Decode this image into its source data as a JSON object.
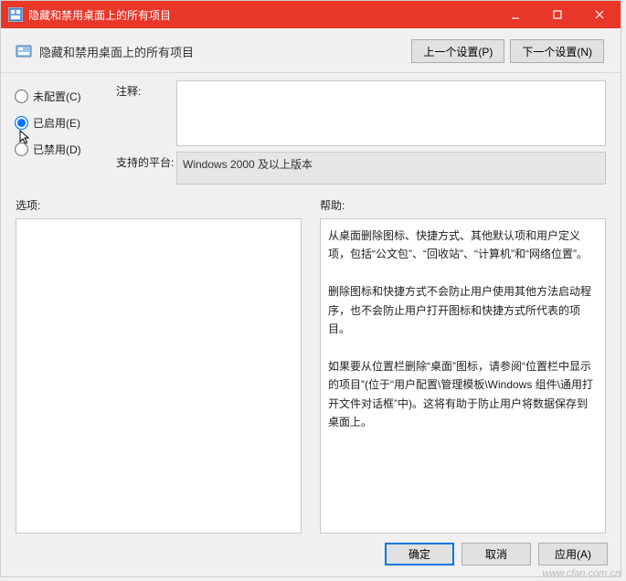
{
  "window": {
    "title": "隐藏和禁用桌面上的所有项目"
  },
  "header": {
    "policy_name": "隐藏和禁用桌面上的所有项目",
    "prev_button": "上一个设置(P)",
    "next_button": "下一个设置(N)"
  },
  "radios": {
    "not_configured": "未配置(C)",
    "enabled": "已启用(E)",
    "disabled": "已禁用(D)",
    "selected": "enabled"
  },
  "form": {
    "comment_label": "注释:",
    "comment_value": "",
    "platform_label": "支持的平台:",
    "platform_value": "Windows 2000 及以上版本"
  },
  "lower": {
    "options_label": "选项:",
    "help_label": "帮助:",
    "help_text": "从桌面删除图标、快捷方式、其他默认项和用户定义项，包括“公文包”、“回收站”、“计算机”和“网络位置”。\n\n删除图标和快捷方式不会防止用户使用其他方法启动程序，也不会防止用户打开图标和快捷方式所代表的项目。\n\n如果要从位置栏删除“桌面”图标，请参阅“位置栏中显示的项目”(位于“用户配置\\管理模板\\Windows 组件\\通用打开文件对话框”中)。这将有助于防止用户将数据保存到桌面上。"
  },
  "footer": {
    "ok": "确定",
    "cancel": "取消",
    "apply": "应用(A)"
  },
  "watermark": "www.cfan.com.cn"
}
